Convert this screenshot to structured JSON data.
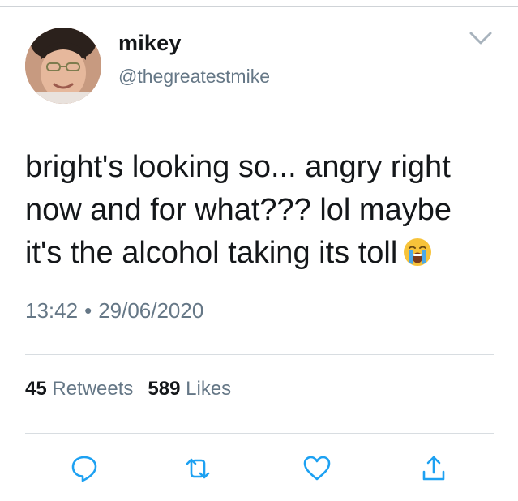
{
  "user": {
    "display_name": "mikey",
    "handle": "@thegreatestmike",
    "avatar_icon": "profile-photo"
  },
  "tweet": {
    "lines": [
      "bright's looking so... angry right",
      "now and for what??? lol maybe",
      "it's the alcohol taking its toll"
    ],
    "emoji": "loudly-crying-face",
    "time": "13:42",
    "separator": "•",
    "date": "29/06/2020"
  },
  "stats": {
    "retweets_count": "45",
    "retweets_label": "Retweets",
    "likes_count": "589",
    "likes_label": "Likes"
  },
  "actions": {
    "reply_icon": "reply-icon",
    "retweet_icon": "retweet-icon",
    "like_icon": "heart-icon",
    "share_icon": "share-icon"
  },
  "colors": {
    "text_primary": "#14171a",
    "text_secondary": "#657786",
    "accent": "#1da1f2",
    "divider": "#d8dde1"
  }
}
